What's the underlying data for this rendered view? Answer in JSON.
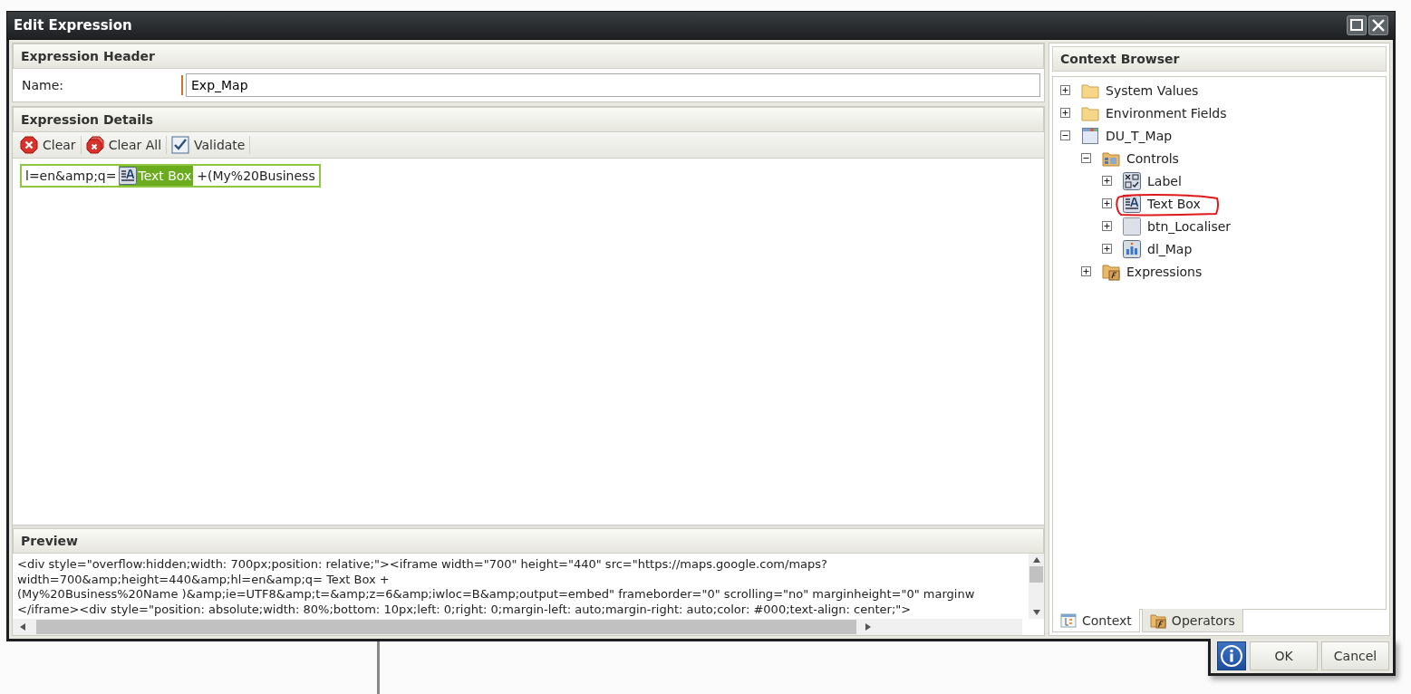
{
  "window": {
    "title": "Edit Expression"
  },
  "expression_header": {
    "title": "Expression Header",
    "name_label": "Name:",
    "name_value": "Exp_Map"
  },
  "expression_details": {
    "title": "Expression Details",
    "toolbar": [
      {
        "kind": "clear",
        "label": "Clear"
      },
      {
        "kind": "clear_all",
        "label": "Clear All"
      },
      {
        "kind": "validate",
        "label": "Validate"
      }
    ],
    "tokens": [
      {
        "kind": "text",
        "text": "l=en&amp;q="
      },
      {
        "kind": "field",
        "text": "Text Box"
      },
      {
        "kind": "text",
        "text": "+(My%20Business"
      }
    ]
  },
  "preview": {
    "title": "Preview",
    "lines": [
      "<div style=\"overflow:hidden;width: 700px;position: relative;\"><iframe width=\"700\" height=\"440\" src=\"https://maps.google.com/maps?",
      "width=700&amp;height=440&amp;hl=en&amp;q= Text Box +",
      "(My%20Business%20Name )&amp;ie=UTF8&amp;t=&amp;z=6&amp;iwloc=B&amp;output=embed\" frameborder=\"0\" scrolling=\"no\" marginheight=\"0\" marginw",
      "</iframe><div style=\"position: absolute;width: 80%;bottom: 10px;left: 0;right: 0;margin-left: auto;margin-right: auto;color: #000;text-align: center;\">"
    ]
  },
  "context_browser": {
    "title": "Context Browser",
    "tree": [
      {
        "label": "System Values",
        "kind": "folder",
        "expanded": false,
        "circled": false
      },
      {
        "label": "Environment Fields",
        "kind": "folder",
        "expanded": false,
        "circled": false
      },
      {
        "label": "DU_T_Map",
        "kind": "form",
        "expanded": true,
        "circled": false,
        "children": [
          {
            "label": "Controls",
            "kind": "controls",
            "expanded": true,
            "circled": false,
            "children": [
              {
                "label": "Label",
                "kind": "label",
                "expanded": false,
                "circled": false
              },
              {
                "label": "Text Box",
                "kind": "textbox",
                "expanded": false,
                "circled": true
              },
              {
                "label": "btn_Localiser",
                "kind": "button",
                "expanded": false,
                "circled": false
              },
              {
                "label": "dl_Map",
                "kind": "list",
                "expanded": false,
                "circled": false
              }
            ]
          },
          {
            "label": "Expressions",
            "kind": "expressions",
            "expanded": false,
            "circled": false
          }
        ]
      }
    ],
    "tabs": [
      {
        "label": "Context",
        "selected": true
      },
      {
        "label": "Operators",
        "selected": false
      }
    ]
  },
  "buttons": [
    {
      "kind": "info"
    },
    {
      "kind": "text",
      "label": "OK"
    },
    {
      "kind": "text",
      "label": "Cancel"
    }
  ]
}
